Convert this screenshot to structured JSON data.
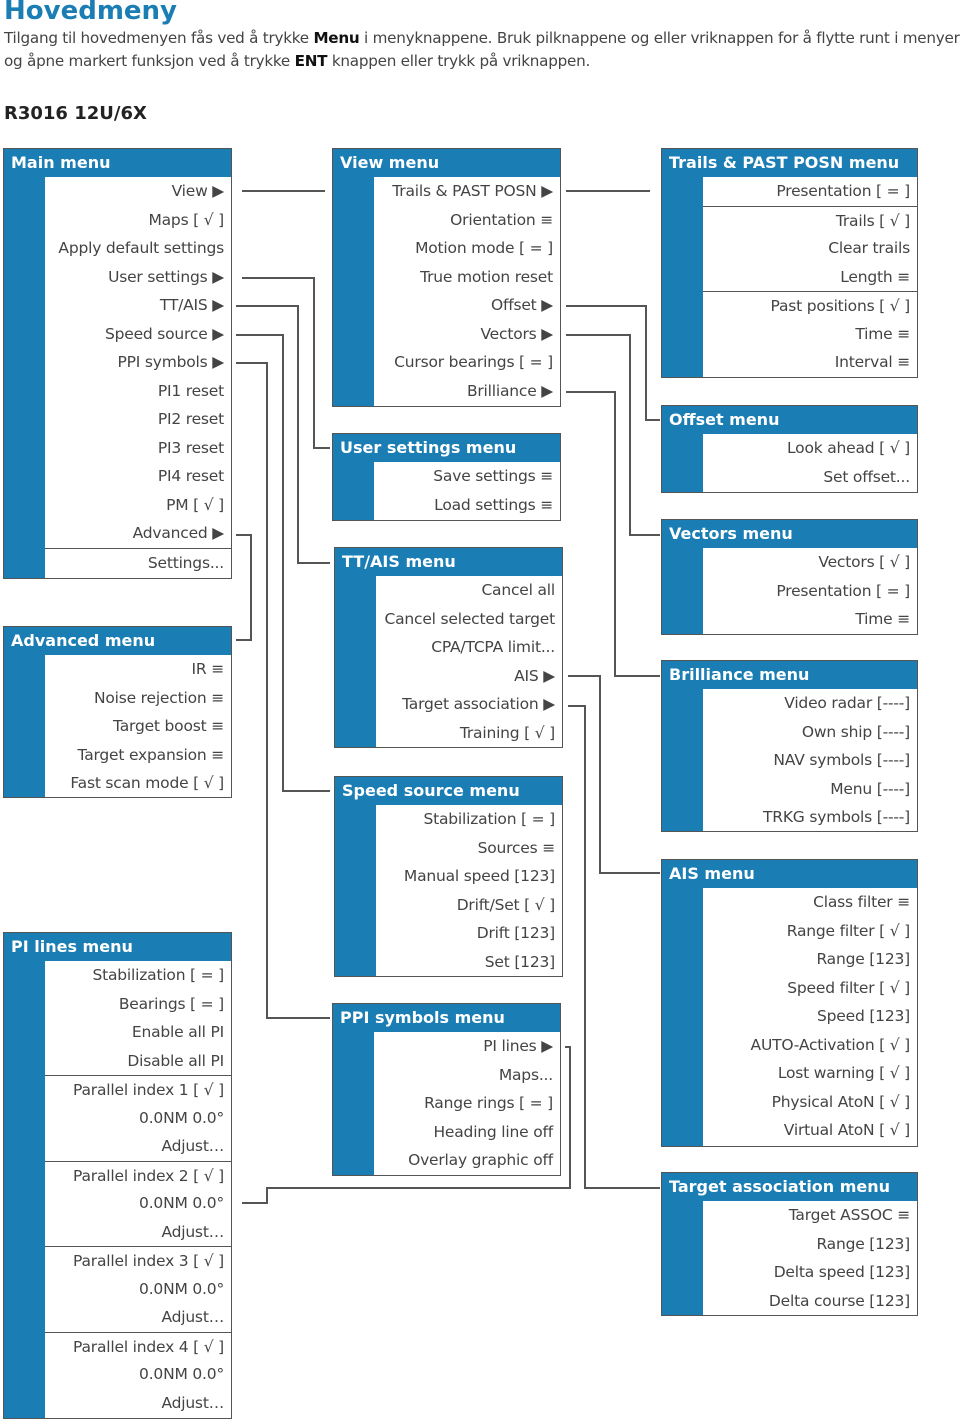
{
  "heading": "Hovedmeny",
  "intro": {
    "p1": "Tilgang til hovedmenyen fås ved å trykke ",
    "b1": "Menu",
    "p2": " i menyknappene. Bruk pilknappene og eller vriknappen for å flytte runt i menyer og åpne markert funksjon ved å trykke ",
    "b2": "ENT",
    "p3": " knappen eller trykk på vriknappen."
  },
  "model": "R3016 12U/6X",
  "colors": {
    "accent": "#1a7db3",
    "border": "#555555"
  },
  "menus": {
    "main": {
      "title": "Main menu",
      "items": [
        {
          "label": "View ▶"
        },
        {
          "label": "Maps  [ √ ]"
        },
        {
          "label": "Apply default settings"
        },
        {
          "label": "User settings ▶"
        },
        {
          "label": "TT/AIS ▶"
        },
        {
          "label": "Speed source  ▶"
        },
        {
          "label": "PPI symbols ▶"
        },
        {
          "label": "PI1 reset"
        },
        {
          "label": "PI2 reset"
        },
        {
          "label": "PI3 reset"
        },
        {
          "label": "PI4 reset"
        },
        {
          "label": "PM [ √ ]"
        },
        {
          "label": "Advanced ▶"
        },
        {
          "label": "Settings...",
          "sep": true
        }
      ]
    },
    "advanced": {
      "title": "Advanced menu",
      "items": [
        {
          "label": "IR ≡"
        },
        {
          "label": "Noise rejection ≡"
        },
        {
          "label": "Target boost ≡"
        },
        {
          "label": "Target expansion ≡"
        },
        {
          "label": "Fast scan mode  [ √ ]"
        }
      ]
    },
    "pi_lines": {
      "title": "PI lines menu",
      "items": [
        {
          "label": "Stabilization  [ = ]"
        },
        {
          "label": "Bearings  [ = ]"
        },
        {
          "label": "Enable all PI"
        },
        {
          "label": "Disable all PI"
        },
        {
          "label": "Parallel index 1  [ √ ]",
          "sep": true
        },
        {
          "label": "0.0NM 0.0°"
        },
        {
          "label": "Adjust…"
        },
        {
          "label": "Parallel index 2  [ √ ]",
          "sep": true
        },
        {
          "label": "0.0NM 0.0°"
        },
        {
          "label": "Adjust…"
        },
        {
          "label": "Parallel index 3  [ √ ]",
          "sep": true
        },
        {
          "label": "0.0NM 0.0°"
        },
        {
          "label": "Adjust…"
        },
        {
          "label": "Parallel index 4  [ √ ]",
          "sep": true
        },
        {
          "label": "0.0NM 0.0°"
        },
        {
          "label": "Adjust…"
        }
      ]
    },
    "view": {
      "title": "View menu",
      "items": [
        {
          "label": "Trails & PAST POSN ▶"
        },
        {
          "label": "Orientation ≡"
        },
        {
          "label": "Motion mode [ = ]"
        },
        {
          "label": "True motion reset"
        },
        {
          "label": "Offset ▶"
        },
        {
          "label": "Vectors ▶"
        },
        {
          "label": "Cursor bearings [ = ]"
        },
        {
          "label": "Brilliance ▶"
        }
      ]
    },
    "user_settings": {
      "title": "User settings menu",
      "items": [
        {
          "label": "Save settings ≡"
        },
        {
          "label": "Load settings ≡"
        }
      ]
    },
    "tt_ais": {
      "title": "TT/AIS menu",
      "items": [
        {
          "label": "Cancel all"
        },
        {
          "label": "Cancel selected target"
        },
        {
          "label": "CPA/TCPA limit..."
        },
        {
          "label": "AIS  ▶"
        },
        {
          "label": "Target association  ▶"
        },
        {
          "label": "Training  [ √ ]"
        }
      ]
    },
    "speed_source": {
      "title": "Speed source menu",
      "items": [
        {
          "label": "Stabilization  [ = ]"
        },
        {
          "label": "Sources  ≡"
        },
        {
          "label": "Manual speed  [123]"
        },
        {
          "label": "Drift/Set  [ √ ]"
        },
        {
          "label": "Drift [123]"
        },
        {
          "label": "Set  [123]"
        }
      ]
    },
    "ppi_symbols": {
      "title": "PPI symbols menu",
      "items": [
        {
          "label": "PI lines ▶"
        },
        {
          "label": "Maps..."
        },
        {
          "label": "Range rings  [ = ]"
        },
        {
          "label": "Heading line off"
        },
        {
          "label": "Overlay graphic off"
        }
      ]
    },
    "trails": {
      "title": "Trails & PAST POSN menu",
      "items": [
        {
          "label": "Presentation [ = ]"
        },
        {
          "label": "Trails  [ √ ]",
          "sep": true
        },
        {
          "label": "Clear trails"
        },
        {
          "label": "Length  ≡"
        },
        {
          "label": "Past positions [ √ ]",
          "sep": true
        },
        {
          "label": "Time  ≡"
        },
        {
          "label": "Interval  ≡"
        }
      ]
    },
    "offset": {
      "title": "Offset menu",
      "items": [
        {
          "label": "Look ahead  [ √ ]"
        },
        {
          "label": "Set offset..."
        }
      ]
    },
    "vectors": {
      "title": "Vectors menu",
      "items": [
        {
          "label": "Vectors  [ √ ]"
        },
        {
          "label": "Presentation [ = ]"
        },
        {
          "label": "Time  ≡"
        }
      ]
    },
    "brilliance": {
      "title": "Brilliance menu",
      "items": [
        {
          "label": "Video radar [----]"
        },
        {
          "label": "Own ship [----]"
        },
        {
          "label": "NAV symbols [----]"
        },
        {
          "label": "Menu [----]"
        },
        {
          "label": "TRKG symbols [----]"
        }
      ]
    },
    "ais": {
      "title": "AIS menu",
      "items": [
        {
          "label": "Class filter   ≡"
        },
        {
          "label": "Range filter [ √ ]"
        },
        {
          "label": "Range [123]"
        },
        {
          "label": "Speed filter [ √ ]"
        },
        {
          "label": "Speed [123]"
        },
        {
          "label": "AUTO-Activation [ √ ]"
        },
        {
          "label": "Lost warning [ √ ]"
        },
        {
          "label": "Physical AtoN [ √ ]"
        },
        {
          "label": "Virtual AtoN [ √ ]"
        }
      ]
    },
    "target_association": {
      "title": "Target association menu",
      "items": [
        {
          "label": "Target ASSOC  ≡"
        },
        {
          "label": "Range [123]"
        },
        {
          "label": "Delta speed [123]"
        },
        {
          "label": "Delta course [123]"
        }
      ]
    }
  }
}
